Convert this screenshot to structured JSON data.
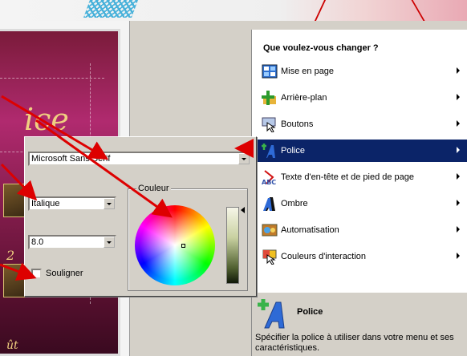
{
  "preview": {
    "title": "ice",
    "subtitle": "2",
    "bottom_text": "ût"
  },
  "task_panel": {
    "title": "Que voulez-vous changer ?",
    "items": [
      {
        "label": "Mise en page",
        "icon": "layout-icon",
        "selected": false
      },
      {
        "label": "Arrière-plan",
        "icon": "background-icon",
        "selected": false
      },
      {
        "label": "Boutons",
        "icon": "buttons-icon",
        "selected": false
      },
      {
        "label": "Police",
        "icon": "font-icon",
        "selected": true
      },
      {
        "label": "Texte d'en-tête et de pied de page",
        "icon": "header-footer-text-icon",
        "selected": false
      },
      {
        "label": "Ombre",
        "icon": "shadow-icon",
        "selected": false
      },
      {
        "label": "Automatisation",
        "icon": "automation-icon",
        "selected": false
      },
      {
        "label": "Couleurs d'interaction",
        "icon": "interaction-colors-icon",
        "selected": false
      }
    ],
    "detail": {
      "title": "Police",
      "description": "Spécifier la police à utiliser dans votre menu et ses caractéristiques."
    }
  },
  "font_dialog": {
    "font_name": "Microsoft Sans Serif",
    "font_style": "Italique",
    "font_size": "8.0",
    "underline_label": "Souligner",
    "underline_checked": false,
    "color_group_label": "Couleur"
  },
  "colors": {
    "selected_menu_bg": "#0b2468",
    "arrow_red": "#dd0000"
  }
}
